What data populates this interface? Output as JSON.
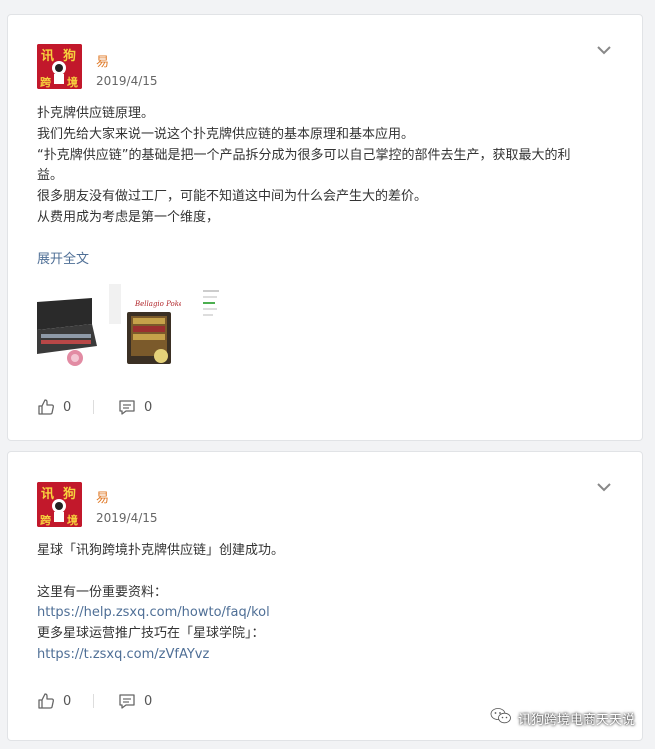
{
  "posts": [
    {
      "author": "易",
      "date": "2019/4/15",
      "lines": [
        "扑克牌供应链原理。",
        "我们先给大家来说一说这个扑克牌供应链的基本原理和基本应用。",
        "“扑克牌供应链”的基础是把一个产品拆分成为很多可以自己掌控的部件去生产，获取最大的利",
        "益。",
        "很多朋友没有做过工厂，可能不知道这中间为什么会产生大的差价。",
        "从费用成为考虑是第一个维度，"
      ],
      "expand_label": "展开全文",
      "thumb_label": "Bellagio Poker",
      "like_count": "0",
      "comment_count": "0"
    },
    {
      "author": "易",
      "date": "2019/4/15",
      "lines": [
        "星球「讯狗跨境扑克牌供应链」创建成功。",
        "",
        "这里有一份重要资料：",
        "https://help.zsxq.com/howto/faq/kol",
        "更多星球运营推广技巧在「星球学院」：",
        "https://t.zsxq.com/zVfAYvz"
      ],
      "like_count": "0",
      "comment_count": "0"
    }
  ],
  "watermark": "讯狗跨境电商天天说",
  "icons": [
    "chevron-down-icon",
    "thumbs-up-icon",
    "comment-icon",
    "wechat-icon"
  ],
  "colors": {
    "author": "#e07b2a",
    "link": "#4f6f96",
    "avatar": "#c2182b"
  }
}
